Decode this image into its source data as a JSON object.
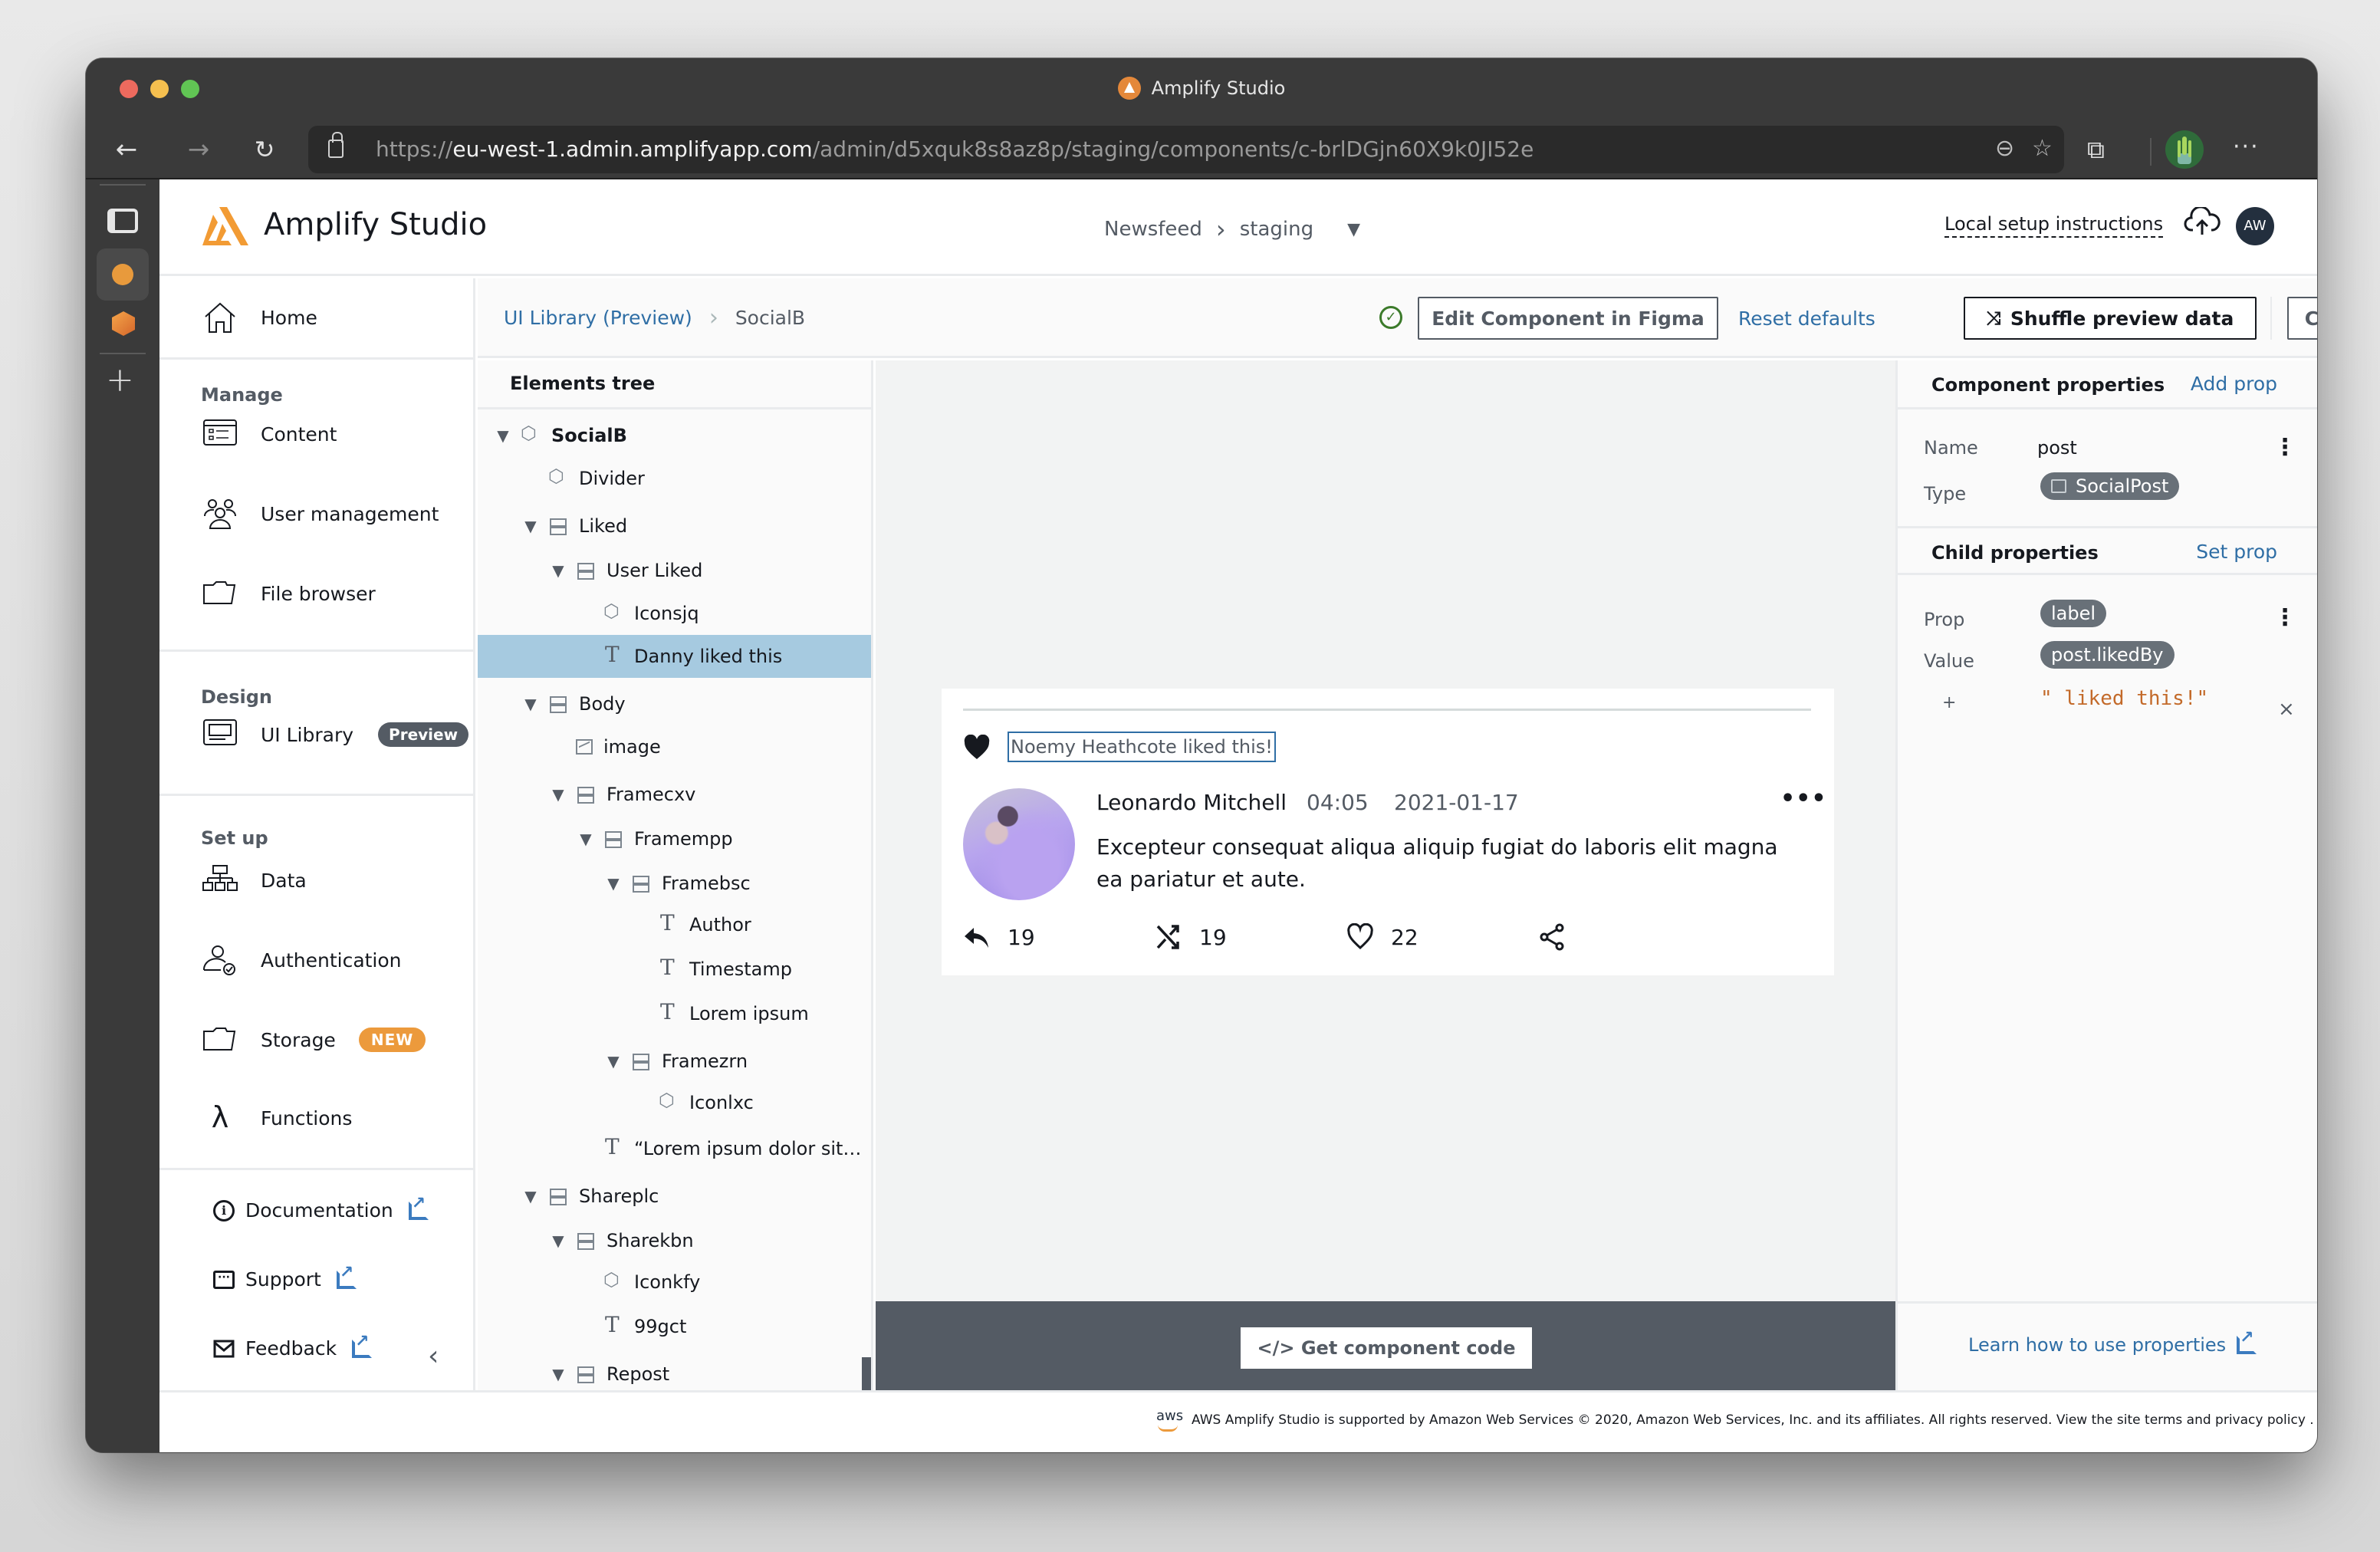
{
  "browser": {
    "window_title": "Amplify Studio",
    "url_scheme": "https://",
    "url_host": "eu-west-1.admin.amplifyapp.com",
    "url_path": "/admin/d5xquk8s8az8p/staging/components/c-brlDGjn60X9k0JI52e"
  },
  "header": {
    "app_name": "Amplify Studio",
    "project": "Newsfeed",
    "environment": "staging",
    "local_setup": "Local setup instructions",
    "avatar_initials": "AW"
  },
  "nav": {
    "home": "Home",
    "manage_title": "Manage",
    "content": "Content",
    "user_management": "User management",
    "file_browser": "File browser",
    "design_title": "Design",
    "ui_library": "UI Library",
    "ui_library_badge": "Preview",
    "setup_title": "Set up",
    "data": "Data",
    "authentication": "Authentication",
    "storage": "Storage",
    "storage_badge": "NEW",
    "functions": "Functions",
    "documentation": "Documentation",
    "support": "Support",
    "feedback": "Feedback"
  },
  "actionbar": {
    "crumb_parent": "UI Library (Preview)",
    "crumb_current": "SocialB",
    "edit_figma": "Edit Component in Figma",
    "reset_defaults": "Reset defaults",
    "shuffle": "Shuffle preview data",
    "create_collection": "Create collection"
  },
  "tree": {
    "title": "Elements tree",
    "items": [
      {
        "label": "SocialB",
        "type": "comp"
      },
      {
        "label": "Divider",
        "type": "comp"
      },
      {
        "label": "Liked",
        "type": "frame"
      },
      {
        "label": "User Liked",
        "type": "frame"
      },
      {
        "label": "Iconsjq",
        "type": "comp"
      },
      {
        "label": "Danny liked this",
        "type": "text"
      },
      {
        "label": "Body",
        "type": "frame"
      },
      {
        "label": "image",
        "type": "img"
      },
      {
        "label": "Framecxv",
        "type": "frame"
      },
      {
        "label": "Framempp",
        "type": "frame"
      },
      {
        "label": "Framebsc",
        "type": "frame"
      },
      {
        "label": "Author",
        "type": "text"
      },
      {
        "label": "Timestamp",
        "type": "text"
      },
      {
        "label": "Lorem ipsum",
        "type": "text"
      },
      {
        "label": "Framezrn",
        "type": "frame"
      },
      {
        "label": "Iconlxc",
        "type": "comp"
      },
      {
        "label": "“Lorem ipsum dolor sit…",
        "type": "text"
      },
      {
        "label": "Shareplc",
        "type": "frame"
      },
      {
        "label": "Sharekbn",
        "type": "frame"
      },
      {
        "label": "Iconkfy",
        "type": "comp"
      },
      {
        "label": "99gct",
        "type": "text"
      },
      {
        "label": "Repost",
        "type": "frame"
      }
    ]
  },
  "preview": {
    "liked_text": "Noemy Heathcote liked this!",
    "author": "Leonardo Mitchell",
    "time": "04:05",
    "date": "2021-01-17",
    "more": "•••",
    "body": "Excepteur consequat aliqua aliquip fugiat do laboris elit magna ea pariatur et aute.",
    "replies": "19",
    "reposts": "19",
    "likes": "22",
    "get_code": "</> Get component code"
  },
  "props": {
    "component_title": "Component properties",
    "add_prop": "Add prop",
    "name_label": "Name",
    "name_value": "post",
    "type_label": "Type",
    "type_value": "SocialPost",
    "child_title": "Child properties",
    "set_prop": "Set prop",
    "prop_label": "Prop",
    "prop_value": "label",
    "value_label": "Value",
    "value_binding": "post.likedBy",
    "concat_plus": "+",
    "concat_string": "\" liked this!\"",
    "learn_link": "Learn how to use properties"
  },
  "footer": {
    "aws": "aws",
    "text": "AWS Amplify Studio is supported by Amazon Web Services © 2020, Amazon Web Services, Inc. and its affiliates. All rights reserved. View the site terms and privacy policy ."
  }
}
